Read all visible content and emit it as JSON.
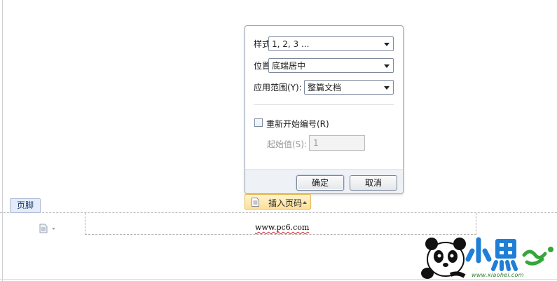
{
  "dialog": {
    "style": {
      "label": "样式(F):",
      "value": "1, 2, 3 ..."
    },
    "position": {
      "label": "位置(L):",
      "value": "底端居中"
    },
    "scope": {
      "label": "应用范围(Y):",
      "value": "整篇文档"
    },
    "restart_numbering": {
      "label": "重新开始编号(R)",
      "checked": false
    },
    "start_value": {
      "label": "起始值(S):",
      "value": "1"
    },
    "ok_label": "确定",
    "cancel_label": "取消"
  },
  "insert_page_number_button": {
    "label": "插入页码"
  },
  "footer": {
    "tag_label": "页脚",
    "text": "www.pc6.com"
  },
  "watermark": {
    "url": "www.xiaohei.com"
  }
}
